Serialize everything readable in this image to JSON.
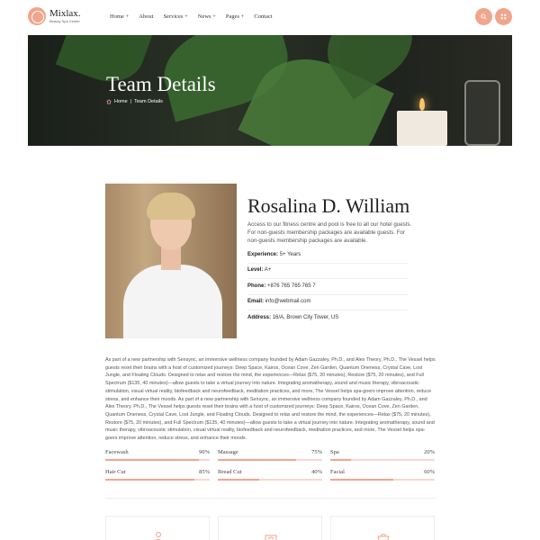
{
  "brand": {
    "name": "Mixlax.",
    "tagline": "Beauty Spa Center",
    "accent_color": "#f0a58c"
  },
  "nav": {
    "items": [
      {
        "label": "Home +"
      },
      {
        "label": "About"
      },
      {
        "label": "Services +"
      },
      {
        "label": "News +"
      },
      {
        "label": "Pages +"
      },
      {
        "label": "Contact"
      }
    ]
  },
  "header_buttons": {
    "search_icon": "search-icon",
    "menu_icon": "grid-menu-icon"
  },
  "hero": {
    "title": "Team Details",
    "breadcrumb_home": "Home",
    "breadcrumb_separator": "|",
    "breadcrumb_current": "Team Details"
  },
  "profile": {
    "name": "Rosalina D. William",
    "intro": "Access to our fitness centre and pool is free to all our hotel guests. For non-guests membership packages are available guests. For non-guests membership packages are available.",
    "details": [
      {
        "label": "Experience:",
        "value": "5+ Years"
      },
      {
        "label": "Level:",
        "value": "A+"
      },
      {
        "label": "Phone:",
        "value": "+876 765 765 765 7"
      },
      {
        "label": "Email:",
        "value": "info@webmail.com"
      },
      {
        "label": "Address:",
        "value": "16/A, Brown City Tower, US"
      }
    ]
  },
  "bio": "As part of a new partnership with Sensync, an immersive wellness company founded by Adam Gazzaley, Ph.D., and Alex Theory, Ph.D., The Vessel helps guests reset their brains with a host of customized journeys: Deep Space, Kairos, Ocean Cove, Zen Garden, Quantum Oneness, Crystal Cave, Lost Jungle, and Floating Clouds. Designed to relax and restore the mind, the experiences—Relax ($75, 20 minutes), Restore ($75, 20 minutes), and Full Spectrum ($135, 40 minutes)—allow guests to take a virtual journey into nature. Integrating aromatherapy, sound and music therapy, vibroacoustic stimulation, visual virtual reality, biofeedback and neurofeedback, meditation practices, and more, The Vessel helps spa-goers improve attention, reduce stress, and enhance their moods. As part of a new partnership with Sensync, an immersive wellness company founded by Adam Gazzaley, Ph.D., and Alex Theory, Ph.D., The Vessel helps guests reset their brains with a host of customized journeys: Deep Space, Kairos, Ocean Cove, Zen Garden, Quantum Oneness, Crystal Cave, Lost Jungle, and Floating Clouds. Designed to relax and restore the mind, the experiences—Relax ($75, 20 minutes), Restore ($75, 20 minutes), and Full Spectrum ($135, 40 minutes)—allow guests to take a virtual journey into nature. Integrating aromatherapy, sound and music therapy, vibroacoustic stimulation, visual virtual reality, biofeedback and neurofeedback, meditation practices, and more, The Vessel helps spa-goers improve attention, reduce stress, and enhance their moods.",
  "skills": [
    {
      "label": "Facewash",
      "percent": "90%",
      "value": 90
    },
    {
      "label": "Massage",
      "percent": "75%",
      "value": 75
    },
    {
      "label": "Spa",
      "percent": "20%",
      "value": 20
    },
    {
      "label": "Hair Cut",
      "percent": "85%",
      "value": 85
    },
    {
      "label": "Bread Cut",
      "percent": "40%",
      "value": 40
    },
    {
      "label": "Facial",
      "percent": "60%",
      "value": 60
    }
  ],
  "cards": [
    {
      "icon": "person-icon"
    },
    {
      "icon": "spa-icon"
    },
    {
      "icon": "basket-icon"
    }
  ]
}
